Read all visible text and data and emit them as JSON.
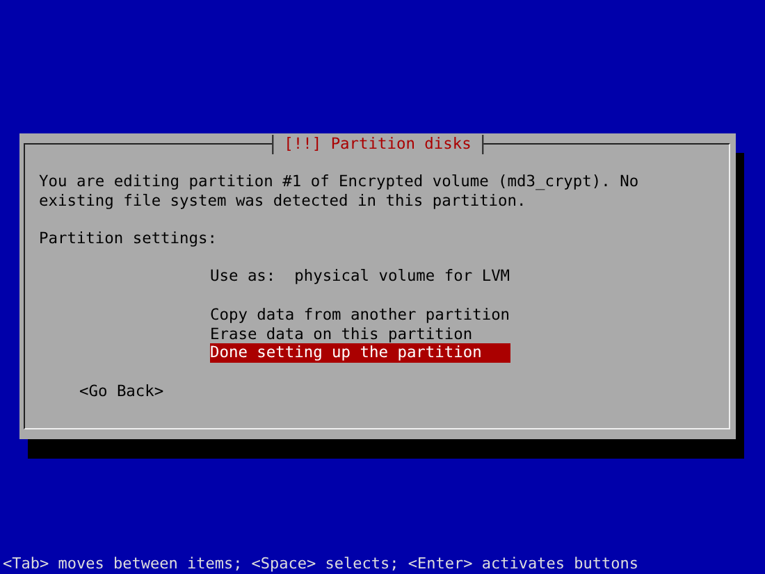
{
  "dialog": {
    "title": "[!!] Partition disks",
    "message": "You are editing partition #1 of Encrypted volume (md3_crypt). No existing file system was detected in this partition.",
    "section_label": "Partition settings:",
    "menu_groups": [
      {
        "items": [
          {
            "label": "Use as:  physical volume for LVM",
            "selected": false
          }
        ]
      },
      {
        "items": [
          {
            "label": "Copy data from another partition",
            "selected": false
          },
          {
            "label": "Erase data on this partition",
            "selected": false
          },
          {
            "label": "Done setting up the partition",
            "selected": true
          }
        ]
      }
    ],
    "buttons": [
      "<Go Back>"
    ]
  },
  "help_line": "<Tab> moves between items; <Space> selects; <Enter> activates buttons"
}
